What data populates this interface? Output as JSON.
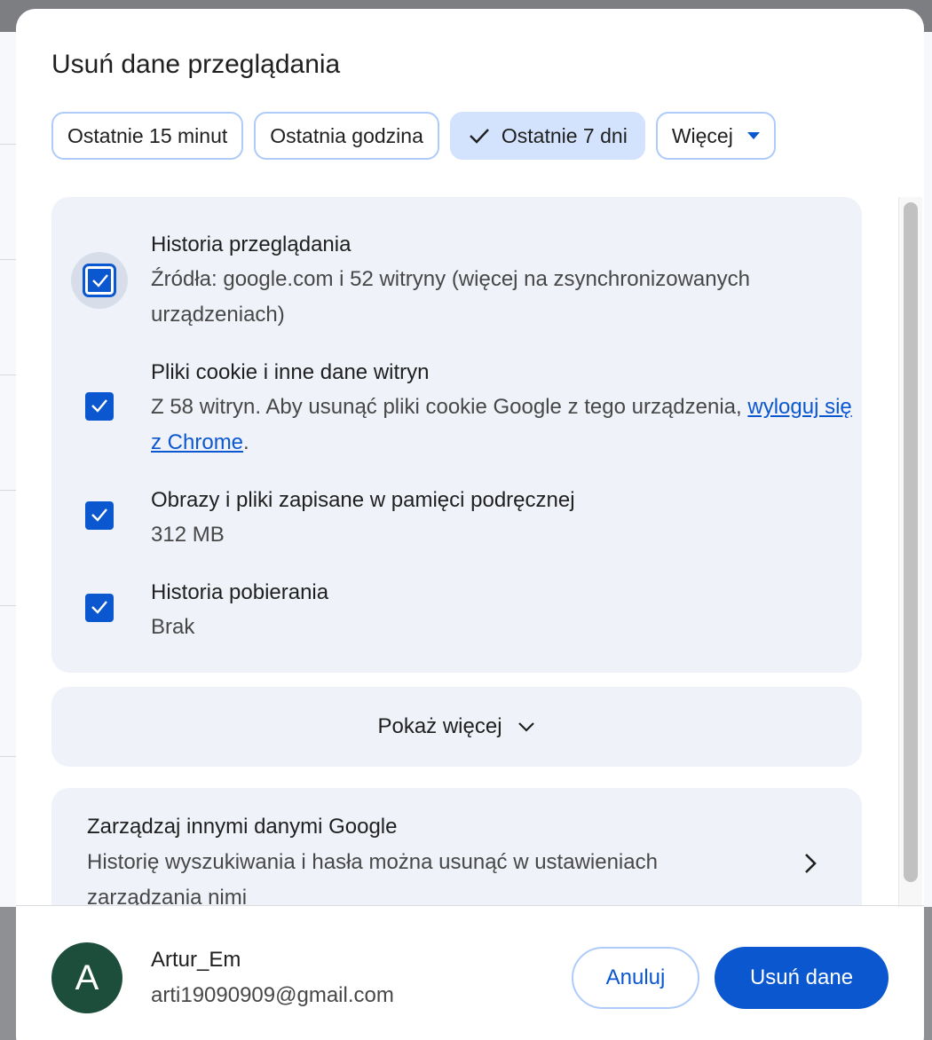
{
  "dialog": {
    "title": "Usuń dane przeglądania"
  },
  "time_ranges": [
    {
      "label": "Ostatnie 15 minut",
      "selected": false
    },
    {
      "label": "Ostatnia godzina",
      "selected": false
    },
    {
      "label": "Ostatnie 7 dni",
      "selected": true
    },
    {
      "label": "Więcej",
      "selected": false,
      "dropdown": true
    }
  ],
  "options": [
    {
      "title": "Historia przeglądania",
      "desc": "Źródła: google.com i 52 witryny (więcej na zsynchronizowanych urządzeniach)",
      "checked": true
    },
    {
      "title": "Pliki cookie i inne dane witryn",
      "desc_before": "Z 58 witryn. Aby usunąć pliki cookie Google z tego urządzenia, ",
      "link": "wyloguj się z Chrome",
      "desc_after": ".",
      "checked": true
    },
    {
      "title": "Obrazy i pliki zapisane w pamięci podręcznej",
      "desc": "312 MB",
      "checked": true
    },
    {
      "title": "Historia pobierania",
      "desc": "Brak",
      "checked": true
    }
  ],
  "show_more": {
    "label": "Pokaż więcej"
  },
  "manage": {
    "title": "Zarządzaj innymi danymi Google",
    "desc": "Historię wyszukiwania i hasła można usunąć w ustawieniach zarządzania nimi"
  },
  "account": {
    "initial": "A",
    "name": "Artur_Em",
    "email": "arti19090909@gmail.com"
  },
  "buttons": {
    "cancel": "Anuluj",
    "delete": "Usuń dane"
  },
  "colors": {
    "accent": "#0b57d0",
    "chip_selected": "#d3e3fd",
    "card_bg": "#eff2f9",
    "avatar_bg": "#1d4e3c"
  }
}
